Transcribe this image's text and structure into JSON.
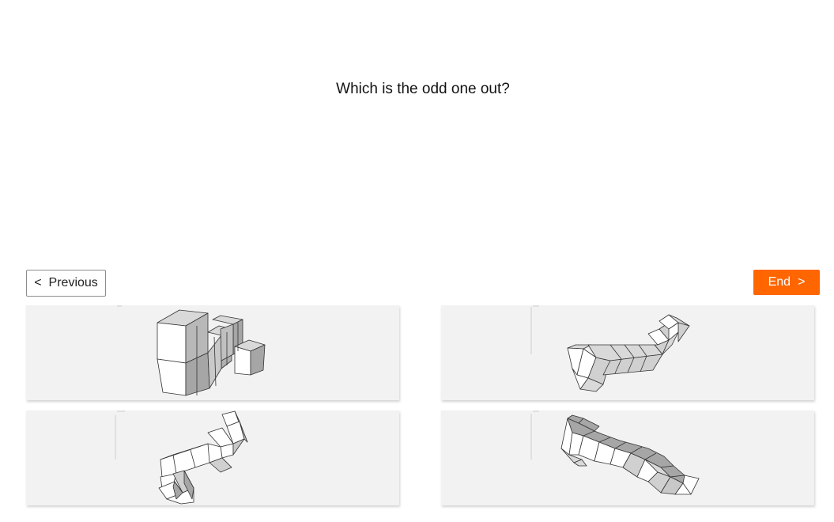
{
  "question": {
    "text": "Which is the odd one out?"
  },
  "navigation": {
    "previous_label": "Previous",
    "previous_chevron": "<",
    "end_label": "End",
    "end_chevron": ">"
  },
  "options": [
    {
      "id": "a",
      "icon": "cube-structure-icon"
    },
    {
      "id": "b",
      "icon": "cube-structure-icon"
    },
    {
      "id": "c",
      "icon": "cube-structure-icon"
    },
    {
      "id": "d",
      "icon": "cube-structure-icon"
    }
  ],
  "colors": {
    "accent": "#ff6600",
    "option_background": "#f2f2f2",
    "cube_light": "#ffffff",
    "cube_mid": "#d9d9d9",
    "cube_dark": "#a6a6a6"
  }
}
